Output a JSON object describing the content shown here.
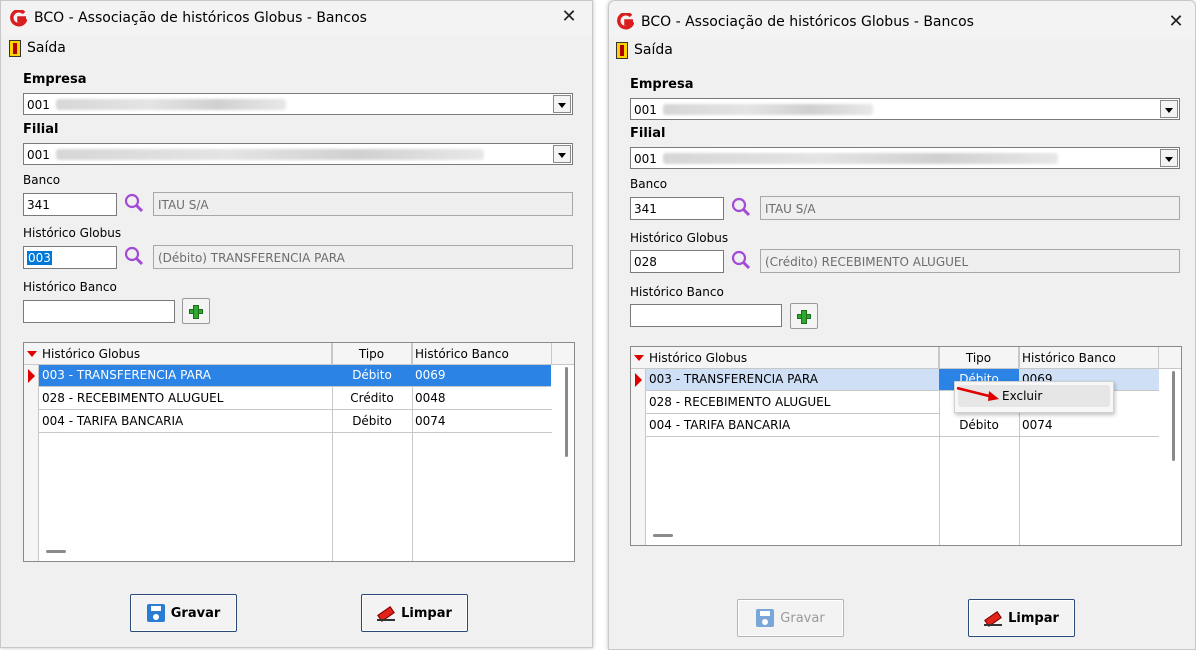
{
  "left_window": {
    "title": "BCO - Associação de históricos Globus - Bancos",
    "menu_exit": "Saída",
    "empresa_label": "Empresa",
    "empresa_value": "001",
    "filial_label": "Filial",
    "filial_value": "001",
    "banco_label": "Banco",
    "banco_code": "341",
    "banco_name": "ITAU S/A",
    "historico_globus_label": "Histórico Globus",
    "historico_globus_code": "003",
    "historico_globus_desc": "(Débito) TRANSFERENCIA PARA",
    "historico_banco_label": "Histórico Banco",
    "historico_banco_value": "",
    "grid": {
      "columns": [
        "Histórico Globus",
        "Tipo",
        "Histórico Banco"
      ],
      "rows": [
        {
          "globus": "003 - TRANSFERENCIA PARA",
          "tipo": "Débito",
          "banco": "0069"
        },
        {
          "globus": "028 - RECEBIMENTO ALUGUEL",
          "tipo": "Crédito",
          "banco": "0048"
        },
        {
          "globus": "004 - TARIFA BANCARIA",
          "tipo": "Débito",
          "banco": "0074"
        }
      ]
    },
    "save_button": "Gravar",
    "clear_button": "Limpar"
  },
  "right_window": {
    "title": "BCO - Associação de históricos Globus - Bancos",
    "menu_exit": "Saída",
    "empresa_label": "Empresa",
    "empresa_value": "001",
    "filial_label": "Filial",
    "filial_value": "001",
    "banco_label": "Banco",
    "banco_code": "341",
    "banco_name": "ITAU S/A",
    "historico_globus_label": "Histórico Globus",
    "historico_globus_code": "028",
    "historico_globus_desc": "(Crédito) RECEBIMENTO ALUGUEL",
    "historico_banco_label": "Histórico Banco",
    "historico_banco_value": "",
    "grid": {
      "columns": [
        "Histórico Globus",
        "Tipo",
        "Histórico Banco"
      ],
      "rows": [
        {
          "globus": "003 - TRANSFERENCIA PARA",
          "tipo": "Débito",
          "banco": "0069"
        },
        {
          "globus": "028 - RECEBIMENTO ALUGUEL",
          "tipo": "",
          "banco": ""
        },
        {
          "globus": "004 - TARIFA BANCARIA",
          "tipo": "Débito",
          "banco": "0074"
        }
      ]
    },
    "context_menu": {
      "item": "Excluir"
    },
    "save_button": "Gravar",
    "clear_button": "Limpar"
  },
  "colors": {
    "selection": "#2b83e6",
    "row_marker": "#e00000",
    "add_icon": "#2ea82e",
    "search_icon": "#a24bd6",
    "logo": "#d81e1e"
  }
}
